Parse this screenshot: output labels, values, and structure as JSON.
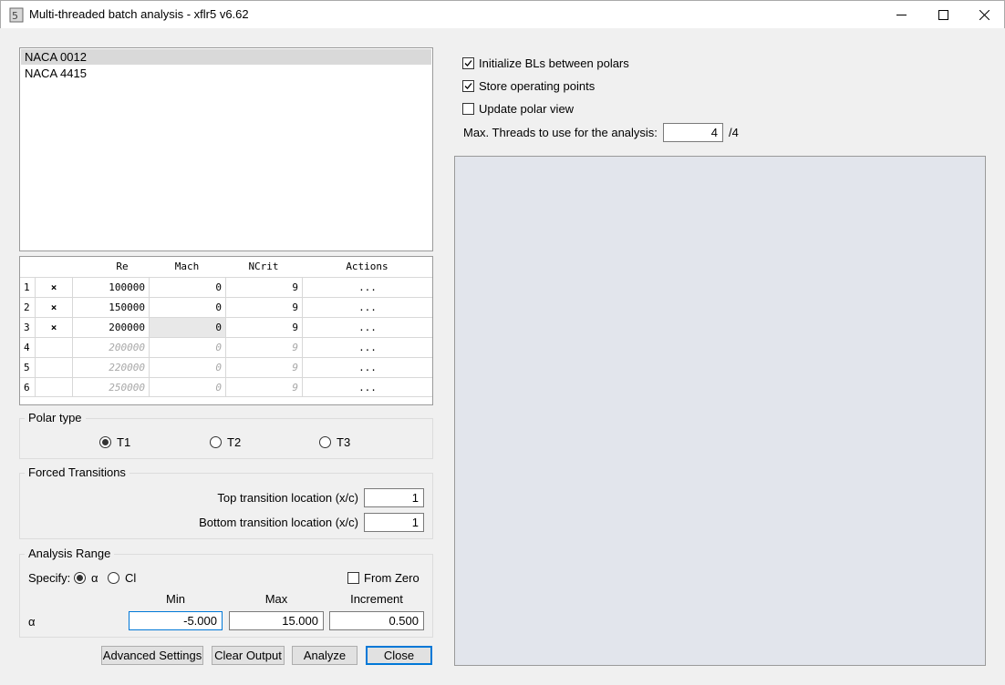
{
  "window": {
    "title": "Multi-threaded batch analysis - xflr5 v6.62",
    "minimize_glyph": "—",
    "maximize_glyph": "☐",
    "close_glyph": "✕"
  },
  "foils": [
    "NACA 0012",
    "NACA 4415"
  ],
  "table": {
    "headers": [
      "Re",
      "Mach",
      "NCrit",
      "Actions"
    ],
    "rows": [
      {
        "num": "1",
        "mark": "×",
        "re": "100000",
        "mach": "0",
        "ncrit": "9",
        "actions": "..."
      },
      {
        "num": "2",
        "mark": "×",
        "re": "150000",
        "mach": "0",
        "ncrit": "9",
        "actions": "..."
      },
      {
        "num": "3",
        "mark": "×",
        "re": "200000",
        "mach": "0",
        "ncrit": "9",
        "actions": "..."
      },
      {
        "num": "4",
        "mark": "",
        "re": "200000",
        "mach": "0",
        "ncrit": "9",
        "actions": "..."
      },
      {
        "num": "5",
        "mark": "",
        "re": "220000",
        "mach": "0",
        "ncrit": "9",
        "actions": "..."
      },
      {
        "num": "6",
        "mark": "",
        "re": "250000",
        "mach": "0",
        "ncrit": "9",
        "actions": "..."
      }
    ]
  },
  "polar_type": {
    "legend": "Polar type",
    "options": [
      "T1",
      "T2",
      "T3"
    ],
    "selected": "T1"
  },
  "forced_transitions": {
    "legend": "Forced Transitions",
    "top_label": "Top transition location (x/c)",
    "top_value": "1",
    "bottom_label": "Bottom transition location (x/c)",
    "bottom_value": "1"
  },
  "analysis_range": {
    "legend": "Analysis Range",
    "specify_label": "Specify:",
    "alpha_option": "α",
    "cl_option": "Cl",
    "from_zero_label": "From Zero",
    "col_min": "Min",
    "col_max": "Max",
    "col_increment": "Increment",
    "row_label": "α",
    "min": "-5.000",
    "max": "15.000",
    "increment": "0.500"
  },
  "buttons": {
    "advanced": "Advanced Settings",
    "clear": "Clear Output",
    "analyze": "Analyze",
    "close": "Close"
  },
  "options": {
    "init_bl": "Initialize BLs between polars",
    "store_opp": "Store operating points",
    "update_view": "Update polar view",
    "threads_label": "Max. Threads to use for the analysis:",
    "threads_value": "4",
    "threads_max": "/4"
  }
}
